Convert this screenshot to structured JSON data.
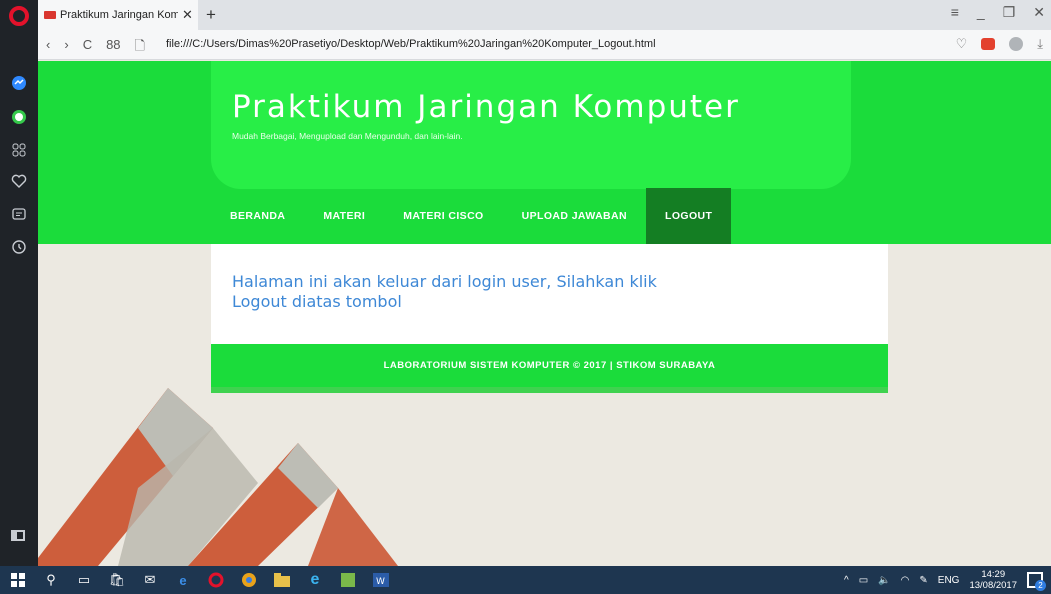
{
  "browser": {
    "tab_title": "Praktikum Jaringan Kompu",
    "tab_close": "✕",
    "new_tab": "+",
    "url": "file:///C:/Users/Dimas%20Prasetiyo/Desktop/Web/Praktikum%20Jaringan%20Komputer_Logout.html",
    "nav": {
      "back": "‹",
      "forward": "›",
      "reload": "C",
      "speed_dial": "88"
    }
  },
  "site": {
    "title": "Praktikum Jaringan Komputer",
    "subtitle": "Mudah Berbagai, Mengupload dan Mengunduh, dan lain-lain.",
    "menu": [
      {
        "label": "BERANDA"
      },
      {
        "label": "MATERI"
      },
      {
        "label": "MATERI CISCO"
      },
      {
        "label": "UPLOAD JAWABAN"
      },
      {
        "label": "LOGOUT"
      }
    ],
    "message": "Halaman ini akan keluar dari login user, Silahkan klik Logout diatas tombol",
    "footer": "LABORATORIUM SISTEM KOMPUTER © 2017 | STIKOM SURABAYA"
  },
  "taskbar": {
    "language": "ENG",
    "time": "14:29",
    "date": "13/08/2017",
    "notifications": "2"
  },
  "colors": {
    "header_green": "#1bdc3b",
    "active_menu": "#147e23",
    "message_blue": "#3e88d6",
    "taskbar": "#1e3650"
  }
}
